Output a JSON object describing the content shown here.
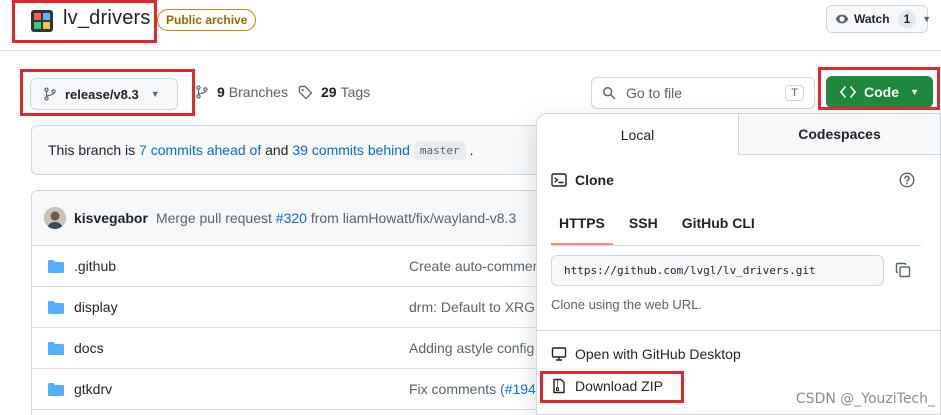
{
  "repo": {
    "name": "lv_drivers",
    "visibility_badge": "Public archive",
    "watch_label": "Watch",
    "watch_count": "1"
  },
  "branch": {
    "current": "release/v8.3",
    "branches_count": "9",
    "branches_label": "Branches",
    "tags_count": "29",
    "tags_label": "Tags"
  },
  "search": {
    "placeholder": "Go to file",
    "shortcut": "T"
  },
  "code_button": {
    "label": "Code"
  },
  "ahead_bar": {
    "prefix": "This branch is",
    "ahead_link": "7 commits ahead of",
    "middle": "and",
    "behind_link": "39 commits behind",
    "base_branch": "master",
    "suffix": "."
  },
  "latest_commit": {
    "author": "kisvegabor",
    "message_prefix": "Merge pull request",
    "pr": "#320",
    "message_suffix": "from liamHowatt/fix/wayland-v8.3"
  },
  "files": [
    {
      "name": ".github",
      "message": "Create auto-commen"
    },
    {
      "name": "display",
      "message": "drm: Default to XRGB"
    },
    {
      "name": "docs",
      "message": "Adding astyle config"
    },
    {
      "name": "gtkdrv",
      "message": "Fix comments (",
      "link": "#194",
      "after": ")"
    }
  ],
  "dropdown": {
    "tabs": [
      "Local",
      "Codespaces"
    ],
    "clone_title": "Clone",
    "protocols": [
      "HTTPS",
      "SSH",
      "GitHub CLI"
    ],
    "clone_url": "https://github.com/lvgl/lv_drivers.git",
    "clone_hint": "Clone using the web URL.",
    "open_desktop": "Open with GitHub Desktop",
    "download_zip": "Download ZIP"
  },
  "watermark": "CSDN @_YouziTech_",
  "colors": {
    "primary_green": "#1f883d",
    "link_blue": "#0969da",
    "highlight_red": "#e0282e",
    "archive_badge": "#9a6700"
  }
}
